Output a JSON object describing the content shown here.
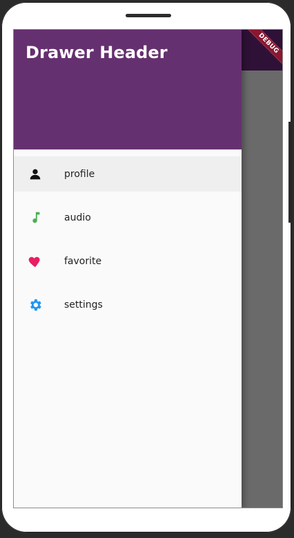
{
  "drawer": {
    "header_title": "Drawer Header",
    "items": [
      {
        "label": "profile",
        "icon": "person-icon",
        "color": "#111111",
        "selected": true
      },
      {
        "label": "audio",
        "icon": "music-note-icon",
        "color": "#4caf50",
        "selected": false
      },
      {
        "label": "favorite",
        "icon": "heart-icon",
        "color": "#e91e63",
        "selected": false
      },
      {
        "label": "settings",
        "icon": "gear-icon",
        "color": "#2196f3",
        "selected": false
      }
    ]
  },
  "debug_banner": {
    "label": "DEBUG"
  },
  "colors": {
    "header": "#65306f",
    "drawer_background": "#fafafa",
    "selected_row": "#efefef",
    "scrim": "#6d6d6d",
    "appbar": "#30123a",
    "debug_ribbon": "#8a1730"
  }
}
